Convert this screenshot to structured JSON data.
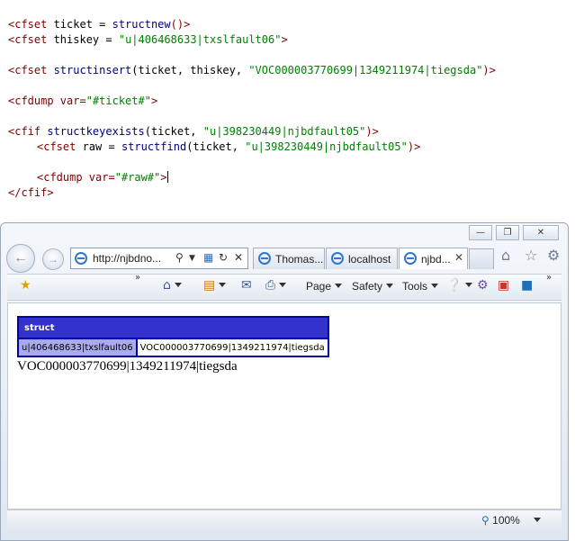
{
  "code_lines": [
    {
      "tag": "<cfset ",
      "fn": "ticket = ",
      "func": "structnew",
      "rest": "()>"
    },
    {
      "tag": "<cfset ",
      "fn": "thiskey = ",
      "str": "\"u|406468633|txslfault06\"",
      "rest": ">"
    }
  ],
  "code": {
    "l1_a": "<cfset",
    "l1_b": " ticket = ",
    "l1_c": "structnew",
    "l1_d": "()>",
    "l2_a": "<cfset",
    "l2_b": " thiskey = ",
    "l2_c": "\"u|406468633|txslfault06\"",
    "l2_d": ">",
    "l3_a": "<cfset",
    "l3_b": " structinsert",
    "l3_c": "(ticket, thiskey, ",
    "l3_d": "\"VOC000003770699|1349211974|tiegsda\"",
    "l3_e": ")>",
    "l4_a": "<cfdump",
    "l4_b": " var=",
    "l4_c": "\"#ticket#\"",
    "l4_d": ">",
    "l5_a": "<cfif",
    "l5_b": " structkeyexists",
    "l5_c": "(ticket, ",
    "l5_d": "\"u|398230449|njbdfault05\"",
    "l5_e": ")>",
    "l6_a": "<cfset",
    "l6_b": " raw = ",
    "l6_c": "structfind",
    "l6_d": "(ticket, ",
    "l6_e": "\"u|398230449|njbdfault05\"",
    "l6_f": ")>",
    "l7_a": "<cfdump",
    "l7_b": " var=",
    "l7_c": "\"#raw#\"",
    "l7_d": ">",
    "l8_a": "</cfif>"
  },
  "browser": {
    "address_url": "http://njbdno...",
    "tabs": [
      {
        "label": "Thomas..."
      },
      {
        "label": "localhost"
      },
      {
        "label": "njbd..."
      }
    ],
    "command_bar": {
      "page_label": "Page",
      "safety_label": "Safety",
      "tools_label": "Tools"
    },
    "zoom": "100%"
  },
  "dump": {
    "header": "struct",
    "key": "u|406468633|txslfault06",
    "value": "VOC000003770699|1349211974|tiegsda"
  },
  "output_text": "VOC000003770699|1349211974|tiegsda",
  "colors": {
    "dump_header": "#3333cc",
    "dump_key_bg": "#aaaaee",
    "dump_border": "#0000aa",
    "code_tag": "#800000",
    "code_function": "#000080",
    "code_string": "#008000"
  },
  "icons": [
    "back-icon",
    "forward-icon",
    "ie-icon",
    "search-icon",
    "compat-view-icon",
    "refresh-icon",
    "stop-icon",
    "close-tab-icon",
    "home-icon",
    "favorites-icon",
    "settings-icon",
    "favorites-bar-icon",
    "rss-icon",
    "mail-icon",
    "print-icon",
    "help-icon",
    "zoom-icon"
  ]
}
